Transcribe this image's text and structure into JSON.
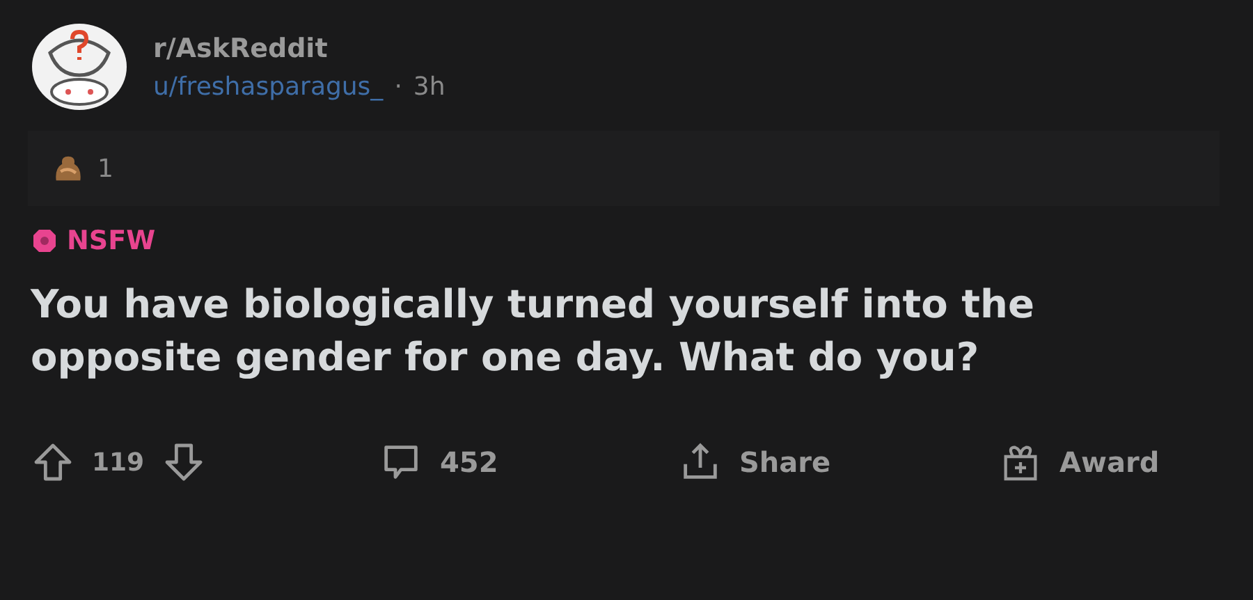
{
  "post": {
    "subreddit": "r/AskReddit",
    "author": "u/freshasparagus_",
    "separator": "·",
    "age": "3h",
    "awards": [
      {
        "count": "1"
      }
    ],
    "nsfw": true,
    "nsfw_label": "NSFW",
    "title": "You have biologically turned yourself into the opposite gender for one day. What do you?"
  },
  "actions": [
    {
      "kind": "vote",
      "score": "119"
    },
    {
      "kind": "comments",
      "label": "452"
    },
    {
      "kind": "share",
      "label": "Share"
    },
    {
      "kind": "award",
      "label": "Award"
    }
  ]
}
